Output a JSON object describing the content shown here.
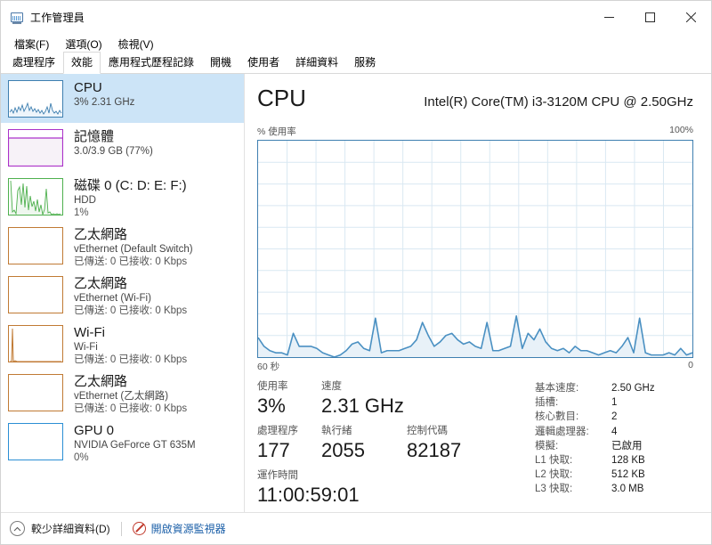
{
  "window": {
    "title": "工作管理員",
    "icon": "task-manager-icon",
    "minimize_label": "−",
    "maximize_label": "□",
    "close_label": "✕"
  },
  "menu": [
    {
      "label": "檔案(F)"
    },
    {
      "label": "選項(O)"
    },
    {
      "label": "檢視(V)"
    }
  ],
  "tabs": [
    {
      "label": "處理程序",
      "active": false
    },
    {
      "label": "效能",
      "active": true
    },
    {
      "label": "應用程式歷程記錄",
      "active": false
    },
    {
      "label": "開機",
      "active": false
    },
    {
      "label": "使用者",
      "active": false
    },
    {
      "label": "詳細資料",
      "active": false
    },
    {
      "label": "服務",
      "active": false
    }
  ],
  "sidebar": {
    "items": [
      {
        "name": "cpu",
        "title": "CPU",
        "sub": "3%  2.31 GHz",
        "sub2": "",
        "color": "#3e7fb0",
        "fill": "#eef5fb",
        "selected": true,
        "graph": "spiky-low"
      },
      {
        "name": "memory",
        "title": "記憶體",
        "sub": "3.0/3.9 GB (77%)",
        "sub2": "",
        "color": "#ab31c9",
        "fill": "#f3eef5",
        "selected": false,
        "graph": "memory-bar"
      },
      {
        "name": "disk-0",
        "title": "磁碟 0 (C: D: E: F:)",
        "sub": "HDD",
        "sub2": "1%",
        "color": "#4eb04e",
        "fill": "#eef7ee",
        "selected": false,
        "graph": "spiky-tall"
      },
      {
        "name": "ethernet-default-switch",
        "title": "乙太網路",
        "sub": "vEthernet (Default Switch)",
        "sub2": "已傳送: 0 已接收: 0 Kbps",
        "color": "#c07a34",
        "fill": "#faf4ed",
        "selected": false,
        "graph": "flat"
      },
      {
        "name": "ethernet-wifi",
        "title": "乙太網路",
        "sub": "vEthernet (Wi-Fi)",
        "sub2": "已傳送: 0 已接收: 0 Kbps",
        "color": "#c07a34",
        "fill": "#faf4ed",
        "selected": false,
        "graph": "flat"
      },
      {
        "name": "wifi",
        "title": "Wi-Fi",
        "sub": "Wi-Fi",
        "sub2": "已傳送: 0 已接收: 0 Kbps",
        "color": "#c07a34",
        "fill": "#faf4ed",
        "selected": false,
        "graph": "single-spike"
      },
      {
        "name": "ethernet-lan",
        "title": "乙太網路",
        "sub": "vEthernet (乙太網路)",
        "sub2": "已傳送: 0 已接收: 0 Kbps",
        "color": "#c07a34",
        "fill": "#faf4ed",
        "selected": false,
        "graph": "flat"
      },
      {
        "name": "gpu-0",
        "title": "GPU 0",
        "sub": "NVIDIA GeForce GT 635M",
        "sub2": "0%",
        "color": "#2b8fd4",
        "fill": "#eef5fb",
        "selected": false,
        "graph": "flat"
      }
    ]
  },
  "main": {
    "title": "CPU",
    "cpu_name": "Intel(R) Core(TM) i3-3120M CPU @ 2.50GHz",
    "axis_top_left": "% 使用率",
    "axis_top_right": "100%",
    "axis_bottom_left": "60 秒",
    "axis_bottom_right": "0"
  },
  "stats": {
    "utilization_label": "使用率",
    "utilization_value": "3%",
    "speed_label": "速度",
    "speed_value": "2.31 GHz",
    "processes_label": "處理程序",
    "processes_value": "177",
    "threads_label": "執行緒",
    "threads_value": "2055",
    "handles_label": "控制代碼",
    "handles_value": "82187",
    "uptime_label": "運作時間",
    "uptime_value": "11:00:59:01"
  },
  "cpu_info": [
    {
      "key": "基本速度:",
      "value": "2.50 GHz"
    },
    {
      "key": "插槽:",
      "value": "1"
    },
    {
      "key": "核心數目:",
      "value": "2"
    },
    {
      "key": "邏輯處理器:",
      "value": "4"
    },
    {
      "key": "模擬:",
      "value": "已啟用"
    },
    {
      "key": "L1 快取:",
      "value": "128 KB"
    },
    {
      "key": "L2 快取:",
      "value": "512 KB"
    },
    {
      "key": "L3 快取:",
      "value": "3.0 MB"
    }
  ],
  "statusbar": {
    "fewer_details": "較少詳細資料(D)",
    "resource_monitor": "開啟資源監視器"
  },
  "chart_data": {
    "type": "area",
    "title": "CPU % 使用率",
    "xlabel": "",
    "ylabel": "% 使用率",
    "ylim": [
      0,
      100
    ],
    "xlim_seconds": [
      60,
      0
    ],
    "grid": true,
    "line_color": "#4a90c2",
    "fill_color": "#e8f1f8",
    "axis_top_right_label": "100%",
    "axis_bottom_left_label": "60 秒",
    "axis_bottom_right_label": "0",
    "values": [
      9,
      5,
      3,
      2,
      2,
      1,
      11,
      5,
      5,
      5,
      4,
      2,
      1,
      0,
      1,
      3,
      6,
      7,
      4,
      3,
      18,
      2,
      3,
      3,
      3,
      4,
      5,
      8,
      16,
      10,
      5,
      7,
      10,
      11,
      8,
      6,
      7,
      5,
      4,
      16,
      3,
      3,
      4,
      5,
      19,
      4,
      11,
      8,
      13,
      7,
      4,
      3,
      4,
      2,
      5,
      3,
      3,
      2,
      1,
      2,
      3,
      2,
      5,
      9,
      2,
      18,
      2,
      1,
      1,
      1,
      2,
      1,
      4,
      1,
      2
    ],
    "current_value": 3,
    "grid_columns": 15,
    "grid_rows": 10
  }
}
